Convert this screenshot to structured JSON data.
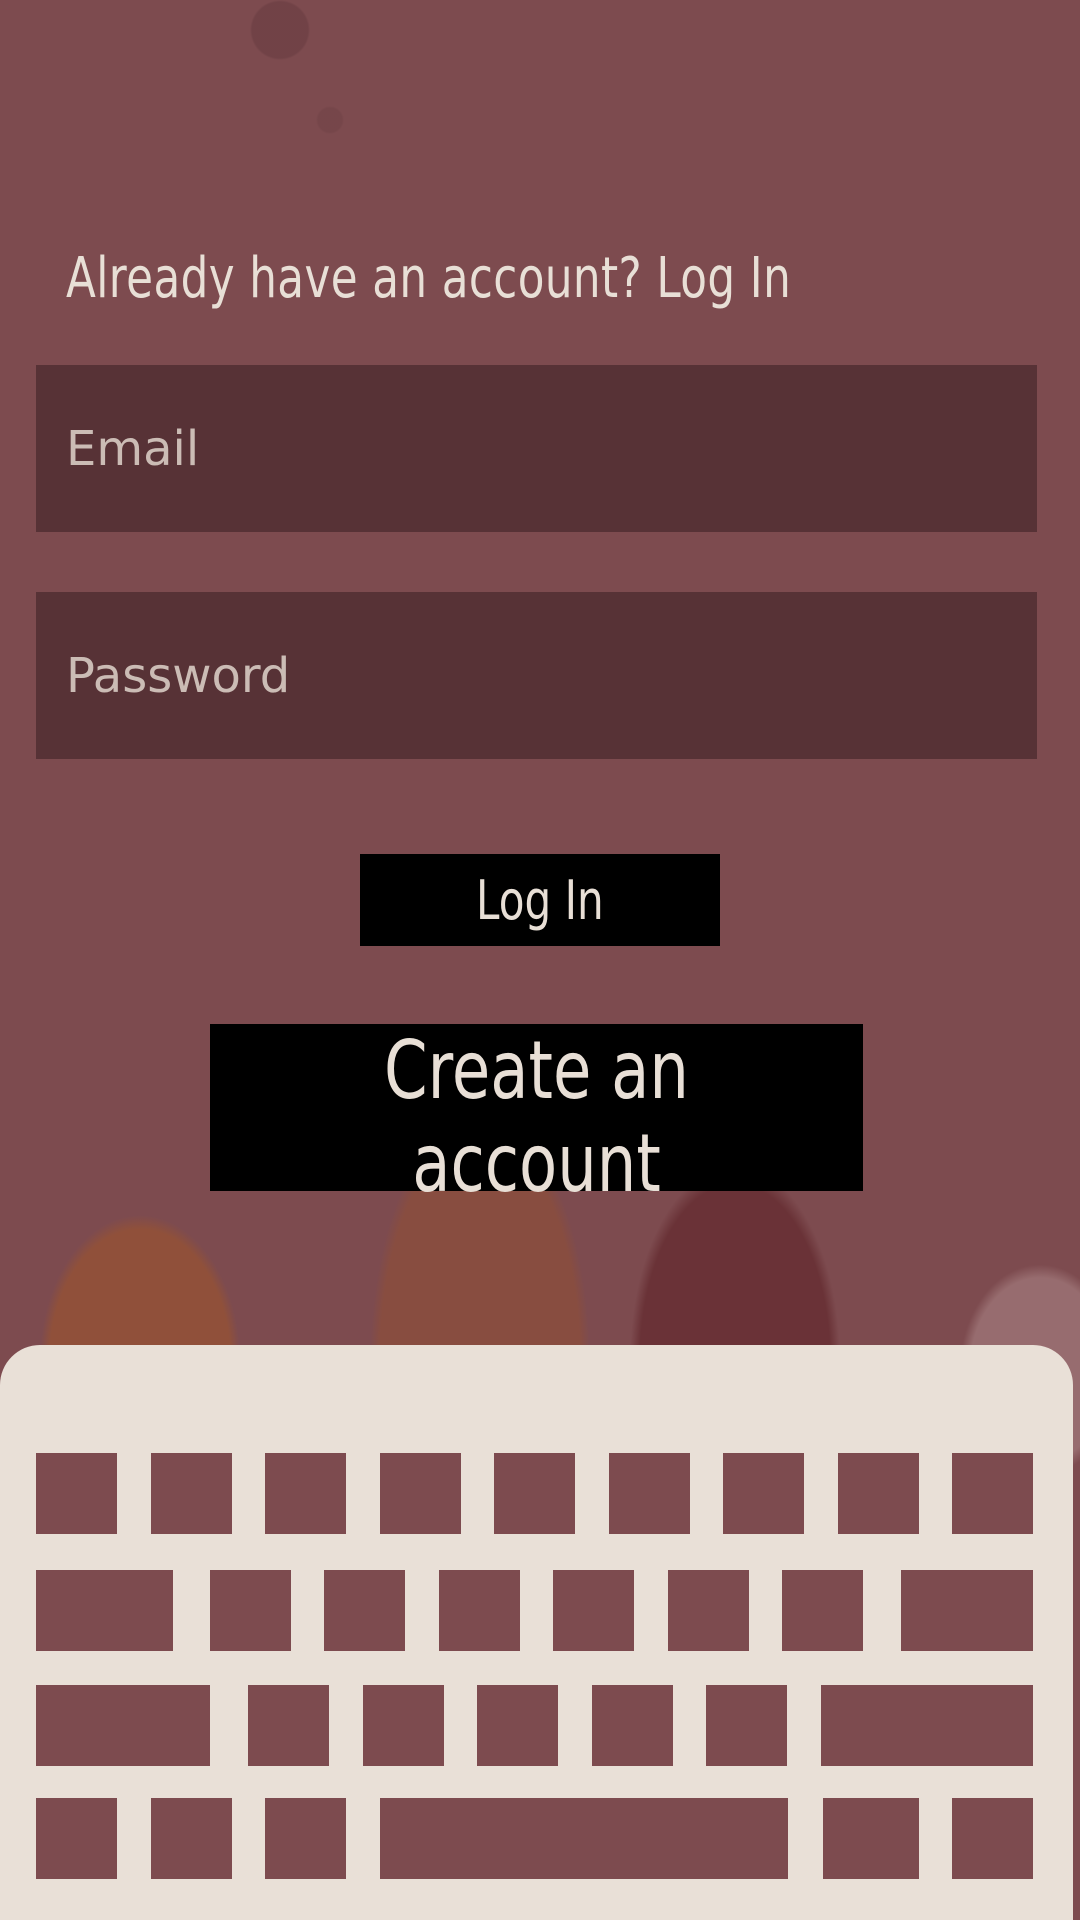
{
  "login": {
    "title": "Already have an account? Log In",
    "email_placeholder": "Email",
    "password_placeholder": "Password",
    "login_label": "Log In",
    "create_label": "Create an account"
  },
  "colors": {
    "background": "#7d4b4f",
    "field_bg": "#52333a",
    "button_bg": "#000000",
    "text": "#e8dfd6",
    "keyboard_bg": "#e9e0d7"
  }
}
